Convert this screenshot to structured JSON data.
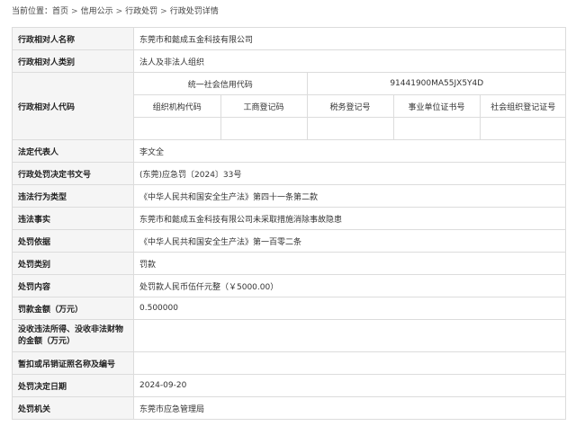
{
  "breadcrumb": {
    "current_label": "当前位置：",
    "items": [
      "首页",
      "信用公示",
      "行政处罚",
      "行政处罚详情"
    ],
    "separator": ">"
  },
  "rows": {
    "name": {
      "label": "行政相对人名称",
      "value": "东莞市和懿成五金科技有限公司"
    },
    "category": {
      "label": "行政相对人类别",
      "value": "法人及非法人组织"
    },
    "code": {
      "label": "行政相对人代码",
      "uscc_label": "统一社会信用代码",
      "uscc_value": "91441900MA55JX5Y4D",
      "org_code_label": "组织机构代码",
      "business_reg_label": "工商登记码",
      "tax_reg_label": "税务登记号",
      "institution_label": "事业单位证书号",
      "social_org_label": "社会组织登记证号"
    },
    "legal_rep": {
      "label": "法定代表人",
      "value": "李文全"
    },
    "decision_no": {
      "label": "行政处罚决定书文号",
      "value": "(东莞)应急罚〔2024〕33号"
    },
    "violation_type": {
      "label": "违法行为类型",
      "value": "《中华人民共和国安全生产法》第四十一条第二款"
    },
    "facts": {
      "label": "违法事实",
      "value": "东莞市和懿成五金科技有限公司未采取措施消除事故隐患"
    },
    "basis": {
      "label": "处罚依据",
      "value": "《中华人民共和国安全生产法》第一百零二条"
    },
    "type": {
      "label": "处罚类别",
      "value": "罚款"
    },
    "content": {
      "label": "处罚内容",
      "value": "处罚款人民币伍仟元整（￥5000.00）"
    },
    "fine_amount": {
      "label": "罚款金额（万元）",
      "value": "0.500000"
    },
    "confiscation": {
      "label": "没收违法所得、没收非法财物的金额（万元）",
      "value": ""
    },
    "license": {
      "label": "暂扣或吊销证照名称及编号",
      "value": ""
    },
    "decision_date": {
      "label": "处罚决定日期",
      "value": "2024-09-20"
    },
    "authority": {
      "label": "处罚机关",
      "value": "东莞市应急管理局"
    }
  }
}
